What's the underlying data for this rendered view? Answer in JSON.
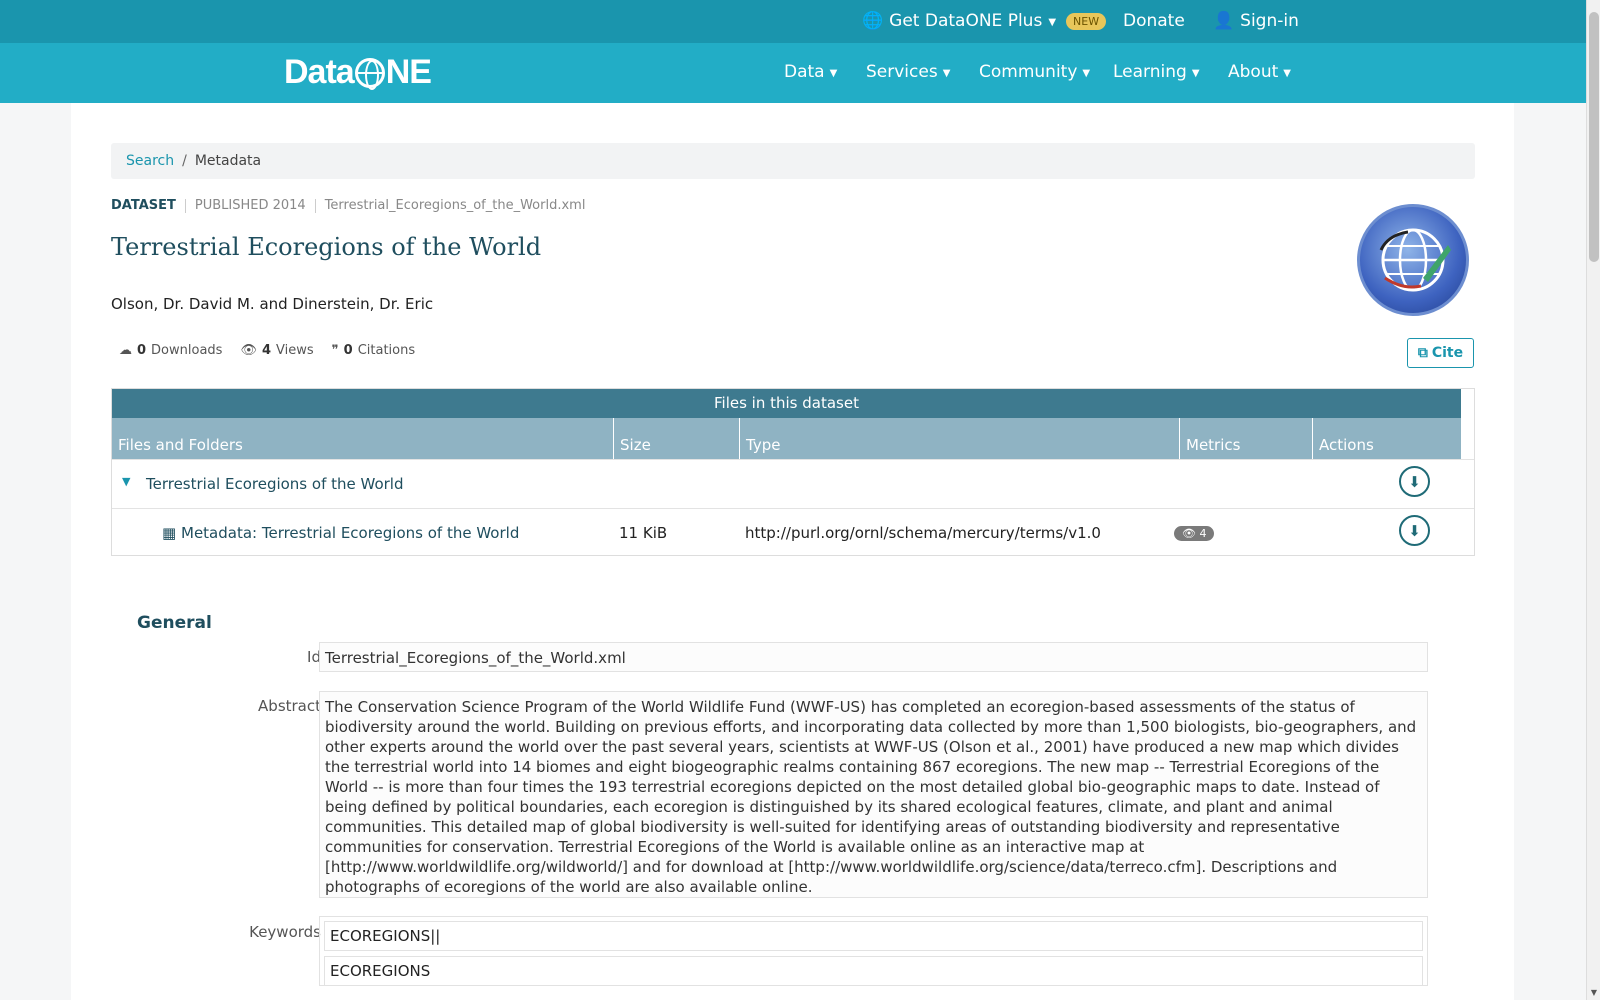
{
  "topbar": {
    "plus_label": "Get DataONE Plus",
    "new_badge": "NEW",
    "donate": "Donate",
    "signin": "Sign-in"
  },
  "nav": {
    "logo_left": "Data",
    "logo_right": "NE",
    "items": [
      "Data",
      "Services",
      "Community",
      "Learning",
      "About"
    ]
  },
  "breadcrumb": {
    "link": "Search",
    "separator": "/",
    "current": "Metadata"
  },
  "dataset": {
    "type": "DATASET",
    "published": "PUBLISHED 2014",
    "filename": "Terrestrial_Ecoregions_of_the_World.xml",
    "title": "Terrestrial Ecoregions of the World",
    "authors": "Olson, Dr. David M. and Dinerstein, Dr. Eric"
  },
  "stats": {
    "downloads_count": "0",
    "downloads_label": "Downloads",
    "views_count": "4",
    "views_label": "Views",
    "citations_count": "0",
    "citations_label": "Citations"
  },
  "cite_label": "Cite",
  "files": {
    "heading": "Files in this dataset",
    "columns": [
      "Files and Folders",
      "Size",
      "Type",
      "Metrics",
      "Actions"
    ],
    "folder": "Terrestrial Ecoregions of the World",
    "file": {
      "name": "Metadata: Terrestrial Ecoregions of the World",
      "size": "11 KiB",
      "type": "http://purl.org/ornl/schema/mercury/terms/v1.0",
      "views": "4"
    }
  },
  "general": {
    "heading": "General",
    "id_label": "Id",
    "id_value": "Terrestrial_Ecoregions_of_the_World.xml",
    "abstract_label": "Abstract",
    "abstract_value": "The Conservation Science Program of the World Wildlife Fund (WWF-US) has completed an ecoregion-based assessments of the status of biodiversity around the world. Building on previous efforts, and incorporating data collected by more than 1,500 biologists, bio-geographers, and other experts around the world over the past several years, scientists at WWF-US (Olson et al., 2001) have produced a new map which divides the terrestrial world into 14 biomes and eight biogeographic realms containing 867 ecoregions. The new map -- Terrestrial Ecoregions of the World -- is more than four times the 193 terrestrial ecoregions depicted on the most detailed global bio-geographic maps to date. Instead of being defined by political boundaries, each ecoregion is distinguished by its shared ecological features, climate, and plant and animal communities. This detailed map of global biodiversity is well-suited for identifying areas of outstanding biodiversity and representative communities for conservation. Terrestrial Ecoregions of the World is available online as an interactive map at [http://www.worldwildlife.org/wildworld/] and for download at [http://www.worldwildlife.org/science/data/terreco.cfm]. Descriptions and photographs of ecoregions of the world are also available online.",
    "keywords_label": "Keywords",
    "keywords": [
      "ECOREGIONS||",
      "ECOREGIONS"
    ]
  }
}
